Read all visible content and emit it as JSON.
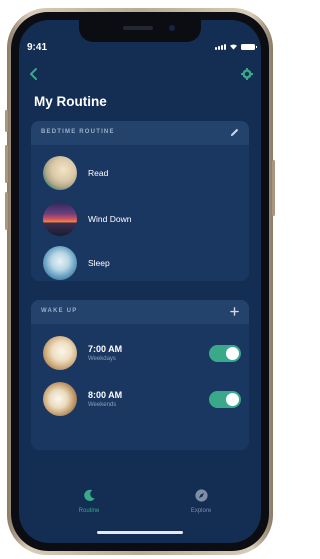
{
  "status_bar": {
    "time": "9:41"
  },
  "header": {
    "title": "My Routine",
    "back_icon": "chevron-left-icon",
    "settings_icon": "gear-icon"
  },
  "bedtime": {
    "section_label": "BEDTIME ROUTINE",
    "action_icon": "pencil-icon",
    "items": [
      {
        "label": "Read"
      },
      {
        "label": "Wind Down"
      },
      {
        "label": "Sleep"
      }
    ]
  },
  "wake_up": {
    "section_label": "WAKE UP",
    "action_icon": "plus-icon",
    "alarms": [
      {
        "time": "7:00 AM",
        "days": "Weekdays",
        "enabled": true
      },
      {
        "time": "8:00 AM",
        "days": "Weekends",
        "enabled": true
      }
    ]
  },
  "tabs": [
    {
      "label": "Routine",
      "icon": "moon-icon",
      "active": true
    },
    {
      "label": "Explore",
      "icon": "compass-icon",
      "active": false
    }
  ],
  "colors": {
    "accent": "#3aa98a",
    "background": "#132d53",
    "card": "#1a3762"
  }
}
